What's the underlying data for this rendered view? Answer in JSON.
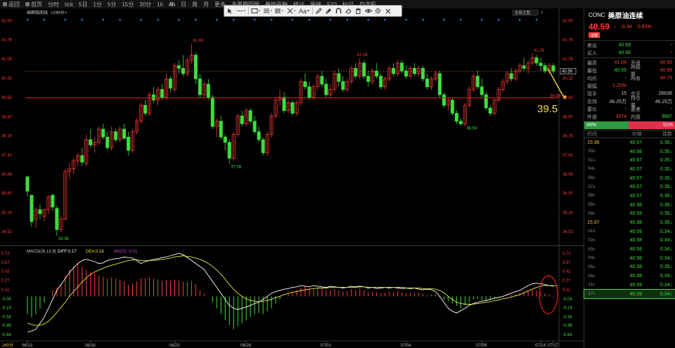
{
  "nav": {
    "items": [
      {
        "label": "返回",
        "icon": "back-icon"
      },
      {
        "label": "首页",
        "icon": "home-icon"
      },
      {
        "label": "分时"
      },
      {
        "label": "tick"
      },
      {
        "label": "5日"
      },
      {
        "label": "1分"
      },
      {
        "label": "5分"
      },
      {
        "label": "15分"
      },
      {
        "label": "30分"
      },
      {
        "label": "1h"
      },
      {
        "label": "4h",
        "active": true
      },
      {
        "label": "日"
      },
      {
        "label": "周"
      },
      {
        "label": "月"
      },
      {
        "label": "更多"
      },
      {
        "label": "多周期同屏"
      },
      {
        "label": "叠加品种"
      },
      {
        "label": "统计"
      },
      {
        "label": "画线"
      },
      {
        "label": "F10"
      },
      {
        "label": "标记"
      },
      {
        "label": "自选股"
      }
    ]
  },
  "chart_header": {
    "label": "画图指南线",
    "period": "<240分>",
    "dropdown": "全部主图"
  },
  "toolbar": {
    "font_label": "Aa",
    "icons": [
      "pointer-icon",
      "line-style-icon",
      "rectangle-tool-icon",
      "text-tool-icon",
      "fibonacci-icon",
      "cross-icon",
      "pencil-icon",
      "brush-icon",
      "magnet-icon",
      "eraser-icon",
      "trash-icon",
      "eye-icon",
      "settings-icon",
      "close-icon"
    ]
  },
  "price_axis": {
    "ticks": [
      "42.50",
      "41.78",
      "41.05",
      "40.32",
      "39.60",
      "38.87",
      "38.15",
      "37.42",
      "36.69",
      "35.97",
      "35.24",
      "34.52"
    ],
    "current_price_tag": "40.59",
    "level_tag": "39.58"
  },
  "annotations": {
    "high_label": "41.63",
    "low_label": "34.36",
    "mid_low_label": "37.08",
    "peak2_label": "41.08",
    "trough3_label": "38.54",
    "recent_high_label": "41.26",
    "target_text": "39.5"
  },
  "date_axis": {
    "labels": [
      "06/13",
      "06/18",
      "06/23",
      "06/26",
      "07/01",
      "07/04",
      "07/09",
      "07/14",
      "07/17"
    ],
    "corner_label": "240分"
  },
  "macd": {
    "legend": {
      "name": "MACD(26,12,9)",
      "diff": "DIFF:0.17",
      "dea": "DEA:0.18",
      "macd": "MACD:-0.01"
    },
    "axis_ticks": [
      "0.72",
      "0.57",
      "0.42",
      "0.27",
      "0.11",
      "-0.04",
      "-0.19",
      "-0.34",
      "-0.48",
      "-0.64"
    ]
  },
  "chart_data": {
    "type": "candlestick",
    "ylim": [
      34.1,
      42.7
    ],
    "ohlc": [
      [
        36.6,
        36.6,
        35.85,
        36.05
      ],
      [
        35.9,
        35.9,
        34.7,
        34.9
      ],
      [
        35.0,
        35.45,
        34.65,
        35.35
      ],
      [
        35.35,
        35.55,
        35.0,
        35.2
      ],
      [
        35.1,
        35.4,
        34.9,
        35.35
      ],
      [
        35.35,
        35.9,
        35.2,
        35.85
      ],
      [
        35.9,
        35.95,
        35.3,
        35.45
      ],
      [
        35.4,
        35.5,
        34.36,
        34.6
      ],
      [
        34.6,
        35.1,
        34.5,
        35.0
      ],
      [
        35.0,
        36.9,
        34.95,
        36.8
      ],
      [
        36.8,
        37.1,
        36.5,
        36.9
      ],
      [
        36.9,
        37.3,
        36.7,
        37.2
      ],
      [
        37.2,
        37.5,
        37.0,
        37.4
      ],
      [
        37.4,
        37.7,
        37.0,
        37.15
      ],
      [
        37.1,
        38.2,
        37.0,
        38.0
      ],
      [
        38.0,
        38.4,
        37.7,
        37.8
      ],
      [
        37.8,
        38.1,
        37.5,
        37.9
      ],
      [
        37.9,
        38.5,
        37.8,
        38.4
      ],
      [
        38.4,
        38.6,
        38.0,
        38.1
      ],
      [
        38.1,
        38.3,
        37.6,
        37.7
      ],
      [
        37.7,
        38.5,
        37.6,
        38.3
      ],
      [
        38.3,
        38.4,
        37.9,
        38.0
      ],
      [
        38.0,
        38.5,
        37.9,
        38.4
      ],
      [
        38.4,
        38.6,
        38.0,
        38.05
      ],
      [
        38.1,
        38.3,
        37.4,
        37.6
      ],
      [
        37.6,
        38.4,
        37.5,
        38.3
      ],
      [
        38.3,
        38.8,
        38.2,
        38.7
      ],
      [
        38.7,
        39.4,
        38.6,
        39.3
      ],
      [
        39.3,
        39.5,
        38.9,
        39.0
      ],
      [
        39.0,
        39.8,
        38.9,
        39.7
      ],
      [
        39.7,
        40.0,
        39.4,
        39.5
      ],
      [
        39.5,
        40.0,
        39.3,
        39.9
      ],
      [
        39.9,
        40.1,
        39.5,
        39.6
      ],
      [
        39.6,
        40.5,
        39.5,
        40.3
      ],
      [
        40.3,
        40.4,
        39.8,
        39.95
      ],
      [
        39.9,
        40.9,
        39.8,
        40.8
      ],
      [
        40.8,
        41.0,
        40.5,
        40.7
      ],
      [
        40.7,
        41.2,
        40.4,
        40.5
      ],
      [
        40.5,
        41.1,
        40.4,
        41.0
      ],
      [
        41.0,
        41.63,
        40.9,
        41.2
      ],
      [
        41.2,
        41.3,
        40.1,
        40.3
      ],
      [
        40.3,
        40.5,
        39.6,
        39.7
      ],
      [
        39.7,
        40.2,
        39.6,
        40.1
      ],
      [
        40.1,
        40.3,
        39.5,
        39.6
      ],
      [
        39.6,
        39.7,
        38.4,
        38.5
      ],
      [
        38.5,
        38.8,
        38.1,
        38.7
      ],
      [
        38.7,
        38.9,
        38.0,
        38.1
      ],
      [
        38.1,
        38.2,
        37.6,
        37.9
      ],
      [
        37.9,
        38.0,
        37.08,
        37.3
      ],
      [
        37.3,
        38.3,
        37.2,
        38.2
      ],
      [
        38.2,
        39.0,
        38.1,
        38.9
      ],
      [
        38.9,
        39.1,
        38.5,
        38.6
      ],
      [
        38.6,
        39.2,
        38.5,
        39.1
      ],
      [
        39.1,
        39.2,
        38.6,
        38.7
      ],
      [
        38.7,
        38.9,
        38.2,
        38.3
      ],
      [
        38.3,
        38.5,
        37.9,
        38.0
      ],
      [
        38.0,
        38.1,
        37.4,
        37.5
      ],
      [
        37.5,
        38.3,
        37.4,
        38.2
      ],
      [
        38.2,
        39.0,
        38.1,
        38.9
      ],
      [
        38.9,
        39.6,
        38.8,
        39.5
      ],
      [
        39.5,
        39.9,
        39.3,
        39.6
      ],
      [
        39.6,
        39.8,
        39.0,
        39.1
      ],
      [
        39.1,
        39.5,
        39.0,
        39.4
      ],
      [
        39.4,
        39.5,
        38.9,
        39.0
      ],
      [
        39.0,
        39.5,
        38.9,
        39.4
      ],
      [
        39.4,
        40.3,
        39.3,
        40.2
      ],
      [
        40.2,
        40.5,
        39.9,
        40.0
      ],
      [
        40.0,
        40.2,
        39.5,
        39.6
      ],
      [
        39.6,
        40.1,
        39.5,
        40.0
      ],
      [
        40.0,
        40.5,
        39.9,
        40.4
      ],
      [
        40.4,
        40.6,
        40.0,
        40.1
      ],
      [
        40.1,
        40.3,
        39.6,
        39.7
      ],
      [
        39.7,
        40.1,
        39.6,
        39.9
      ],
      [
        39.9,
        40.6,
        39.8,
        40.5
      ],
      [
        40.5,
        40.7,
        40.0,
        40.2
      ],
      [
        40.2,
        40.4,
        39.8,
        39.9
      ],
      [
        39.9,
        40.3,
        39.8,
        40.2
      ],
      [
        40.2,
        40.8,
        40.1,
        40.7
      ],
      [
        40.7,
        40.9,
        40.3,
        40.4
      ],
      [
        40.4,
        41.08,
        40.3,
        40.9
      ],
      [
        40.9,
        41.0,
        40.3,
        40.4
      ],
      [
        40.4,
        40.6,
        40.0,
        40.2
      ],
      [
        40.2,
        40.7,
        40.1,
        40.6
      ],
      [
        40.6,
        40.9,
        40.3,
        40.4
      ],
      [
        40.4,
        40.5,
        39.9,
        40.0
      ],
      [
        40.0,
        40.4,
        39.9,
        40.3
      ],
      [
        40.3,
        40.8,
        40.2,
        40.7
      ],
      [
        40.7,
        40.9,
        40.4,
        40.5
      ],
      [
        40.5,
        41.0,
        40.4,
        40.9
      ],
      [
        40.9,
        41.0,
        40.5,
        40.6
      ],
      [
        40.6,
        40.8,
        40.3,
        40.4
      ],
      [
        40.4,
        40.8,
        40.3,
        40.7
      ],
      [
        40.7,
        40.9,
        40.4,
        40.5
      ],
      [
        40.5,
        40.8,
        40.4,
        40.7
      ],
      [
        40.7,
        40.8,
        40.2,
        40.3
      ],
      [
        40.3,
        40.5,
        39.9,
        40.0
      ],
      [
        40.0,
        40.4,
        39.9,
        40.3
      ],
      [
        40.3,
        40.6,
        40.2,
        40.5
      ],
      [
        40.5,
        40.6,
        39.6,
        39.7
      ],
      [
        39.7,
        39.8,
        39.2,
        39.3
      ],
      [
        39.3,
        39.6,
        39.1,
        39.5
      ],
      [
        39.5,
        39.6,
        38.9,
        39.0
      ],
      [
        39.0,
        39.1,
        38.6,
        38.7
      ],
      [
        38.7,
        38.8,
        38.54,
        38.6
      ],
      [
        38.6,
        39.4,
        38.5,
        39.3
      ],
      [
        39.3,
        40.0,
        39.2,
        39.9
      ],
      [
        39.9,
        40.5,
        39.8,
        40.4
      ],
      [
        40.4,
        40.6,
        39.9,
        40.0
      ],
      [
        40.0,
        40.3,
        39.6,
        39.7
      ],
      [
        39.7,
        39.8,
        39.1,
        39.2
      ],
      [
        39.2,
        39.3,
        38.9,
        39.0
      ],
      [
        39.0,
        39.6,
        38.9,
        39.5
      ],
      [
        39.5,
        40.0,
        39.4,
        39.9
      ],
      [
        39.9,
        40.3,
        39.8,
        40.2
      ],
      [
        40.2,
        40.6,
        40.1,
        40.5
      ],
      [
        40.5,
        40.7,
        40.2,
        40.3
      ],
      [
        40.3,
        40.7,
        40.2,
        40.6
      ],
      [
        40.6,
        40.9,
        40.5,
        40.8
      ],
      [
        40.8,
        41.1,
        40.6,
        40.7
      ],
      [
        40.7,
        41.0,
        40.5,
        40.9
      ],
      [
        40.9,
        41.26,
        40.8,
        41.1
      ],
      [
        41.1,
        41.2,
        40.8,
        40.9
      ],
      [
        40.9,
        41.1,
        40.6,
        40.8
      ],
      [
        40.8,
        40.9,
        40.5,
        40.6
      ],
      [
        40.6,
        40.9,
        40.5,
        40.8
      ],
      [
        40.8,
        40.9,
        40.5,
        40.59
      ]
    ],
    "macd_hist": [
      -0.3,
      -0.35,
      -0.3,
      -0.2,
      -0.1,
      0.0,
      0.1,
      0.15,
      0.2,
      0.35,
      0.45,
      0.5,
      0.55,
      0.5,
      0.45,
      0.4,
      0.38,
      0.35,
      0.33,
      0.3,
      0.32,
      0.3,
      0.28,
      0.25,
      0.2,
      0.22,
      0.25,
      0.3,
      0.3,
      0.32,
      0.3,
      0.28,
      0.26,
      0.28,
      0.26,
      0.28,
      0.27,
      0.25,
      0.24,
      0.26,
      0.2,
      0.1,
      0.05,
      0.0,
      -0.1,
      -0.2,
      -0.3,
      -0.4,
      -0.48,
      -0.55,
      -0.5,
      -0.45,
      -0.4,
      -0.35,
      -0.3,
      -0.28,
      -0.3,
      -0.25,
      -0.2,
      -0.12,
      -0.05,
      0.0,
      0.05,
      0.08,
      0.1,
      0.15,
      0.18,
      0.14,
      0.12,
      0.15,
      0.13,
      0.1,
      0.1,
      0.12,
      0.1,
      0.08,
      0.09,
      0.12,
      0.1,
      0.13,
      0.1,
      0.07,
      0.08,
      0.07,
      0.05,
      0.06,
      0.08,
      0.07,
      0.09,
      0.07,
      0.05,
      0.06,
      0.05,
      0.06,
      0.04,
      0.02,
      0.03,
      0.04,
      -0.02,
      -0.06,
      -0.08,
      -0.12,
      -0.16,
      -0.2,
      -0.15,
      -0.1,
      -0.05,
      -0.04,
      -0.06,
      -0.08,
      -0.07,
      -0.04,
      -0.02,
      0.0,
      0.02,
      0.02,
      0.04,
      0.06,
      0.07,
      0.08,
      0.1,
      0.1,
      0.08,
      0.05,
      0.03,
      0.01,
      -0.01
    ],
    "diff": [
      -0.6,
      -0.58,
      -0.55,
      -0.45,
      -0.35,
      -0.2,
      -0.05,
      0.1,
      0.2,
      0.3,
      0.4,
      0.48,
      0.55,
      0.6,
      0.62,
      0.6,
      0.58,
      0.55,
      0.56,
      0.6,
      0.62,
      0.63,
      0.64,
      0.66,
      0.65,
      0.64,
      0.6,
      0.55,
      0.58,
      0.6,
      0.62,
      0.63,
      0.65,
      0.66,
      0.68,
      0.7,
      0.72,
      0.7,
      0.65,
      0.6,
      0.55,
      0.5,
      0.45,
      0.35,
      0.25,
      0.15,
      0.05,
      -0.05,
      -0.15,
      -0.2,
      -0.22,
      -0.2,
      -0.18,
      -0.15,
      -0.12,
      -0.1,
      -0.05,
      0.0,
      0.05,
      0.08,
      0.1,
      0.12,
      0.13,
      0.15,
      0.16,
      0.18,
      0.17,
      0.16,
      0.18,
      0.17,
      0.16,
      0.15,
      0.17,
      0.16,
      0.15,
      0.14,
      0.15,
      0.17,
      0.16,
      0.17,
      0.16,
      0.14,
      0.15,
      0.13,
      0.14,
      0.15,
      0.14,
      0.15,
      0.14,
      0.13,
      0.14,
      0.13,
      0.14,
      0.12,
      0.11,
      0.12,
      0.11,
      0.08,
      0.0,
      -0.1,
      -0.2,
      -0.25,
      -0.28,
      -0.24,
      -0.2,
      -0.15,
      -0.12,
      -0.1,
      -0.08,
      -0.07,
      -0.05,
      -0.03,
      -0.02,
      0.0,
      0.03,
      0.05,
      0.08,
      0.1,
      0.14,
      0.18,
      0.21,
      0.22,
      0.21,
      0.2,
      0.18,
      0.17
    ],
    "dea": [
      -0.45,
      -0.47,
      -0.49,
      -0.48,
      -0.46,
      -0.42,
      -0.35,
      -0.27,
      -0.18,
      -0.1,
      0.0,
      0.08,
      0.16,
      0.24,
      0.31,
      0.37,
      0.41,
      0.44,
      0.47,
      0.5,
      0.52,
      0.54,
      0.56,
      0.58,
      0.6,
      0.61,
      0.61,
      0.6,
      0.6,
      0.6,
      0.6,
      0.61,
      0.62,
      0.63,
      0.64,
      0.66,
      0.67,
      0.68,
      0.67,
      0.66,
      0.64,
      0.62,
      0.59,
      0.55,
      0.5,
      0.44,
      0.37,
      0.29,
      0.2,
      0.12,
      0.05,
      0.0,
      -0.04,
      -0.07,
      -0.08,
      -0.09,
      -0.08,
      -0.07,
      -0.05,
      -0.02,
      0.0,
      0.03,
      0.05,
      0.07,
      0.08,
      0.1,
      0.11,
      0.12,
      0.13,
      0.14,
      0.14,
      0.14,
      0.15,
      0.15,
      0.15,
      0.15,
      0.15,
      0.15,
      0.15,
      0.16,
      0.16,
      0.15,
      0.15,
      0.15,
      0.15,
      0.15,
      0.15,
      0.15,
      0.15,
      0.15,
      0.14,
      0.14,
      0.14,
      0.14,
      0.13,
      0.13,
      0.13,
      0.12,
      0.1,
      0.06,
      0.0,
      -0.05,
      -0.1,
      -0.12,
      -0.13,
      -0.13,
      -0.13,
      -0.12,
      -0.11,
      -0.1,
      -0.09,
      -0.07,
      -0.06,
      -0.04,
      -0.03,
      -0.01,
      0.01,
      0.03,
      0.06,
      0.09,
      0.12,
      0.15,
      0.17,
      0.18,
      0.18,
      0.18,
      0.18
    ]
  },
  "quote": {
    "code": "CONC",
    "name": "美原油连续",
    "price": "40.59",
    "arrow": "↓",
    "change": "-0.34",
    "change_pct": "-0.83%",
    "flag": "设置",
    "bid_label": "卖出",
    "bid": "40.59",
    "bid_vol": "-",
    "ask_label": "买入",
    "ask": "40.58",
    "ask_vol": "-",
    "stats": [
      {
        "l1": "最高",
        "v1": "41.04",
        "c1": "red",
        "l2": "开盘",
        "v2": "40.90"
      },
      {
        "l1": "最低",
        "v1": "40.55",
        "c1": "green",
        "l2": "昨结算",
        "v2": "40.93"
      },
      {
        "l1": "均价",
        "v1": "-",
        "c1": "",
        "l2": "昨收",
        "v2": "40.73"
      },
      {
        "l1": "振幅",
        "v1": "1.20%",
        "c1": "red",
        "l2": "",
        "v2": ""
      },
      {
        "l1": "现手",
        "v1": "15",
        "c1": "",
        "l2": "总手",
        "v2": "26636"
      },
      {
        "l1": "总持",
        "v1": "46.25万",
        "c1": "",
        "l2": "持仓量",
        "v2": "46.25万"
      },
      {
        "l1": "委比",
        "v1": "-",
        "c1": "",
        "l2": "委差",
        "v2": "-"
      },
      {
        "l1": "外盘",
        "v1": "3574",
        "c1": "red",
        "l2": "内盘",
        "v2": "3687"
      }
    ],
    "ratio_left": "49%",
    "ratio_right": "51%",
    "ratio_value": 0.49
  },
  "ticks_table": {
    "headers": [
      "时间",
      "价格",
      "现数"
    ],
    "rows": [
      {
        "t": "15:36",
        "p": "40.57",
        "v": "0.36"
      },
      {
        "t": ":50s",
        "p": "40.58",
        "v": "0.35"
      },
      {
        "t": ":51s",
        "p": "40.57",
        "v": "0.35"
      },
      {
        "t": ":54s",
        "p": "40.57",
        "v": "0.35"
      },
      {
        "t": ":56s",
        "p": "40.57",
        "v": "0.35"
      },
      {
        "t": ":57s",
        "p": "40.57",
        "v": "0.35"
      },
      {
        "t": ":58s",
        "p": "40.57",
        "v": "0.35"
      },
      {
        "t": ":58s",
        "p": "40.58",
        "v": "0.35"
      },
      {
        "t": ":59s",
        "p": "40.59",
        "v": "0.35"
      },
      {
        "t": "15:37",
        "p": "40.58",
        "v": "0.35"
      },
      {
        "t": ":01s",
        "p": "40.59",
        "v": "0.34"
      },
      {
        "t": ":02s",
        "p": "40.58",
        "v": "0.34"
      },
      {
        "t": ":03s",
        "p": "40.59",
        "v": "0.34"
      },
      {
        "t": ":04s",
        "p": "40.58",
        "v": "0.34"
      },
      {
        "t": ":05s",
        "p": "40.58",
        "v": "0.35"
      },
      {
        "t": ":06s",
        "p": "40.58",
        "v": "0.34"
      },
      {
        "t": ":11s",
        "p": "40.59",
        "v": "0.34"
      },
      {
        "t": ":17s",
        "p": "40.59",
        "v": "0.34",
        "selected": true
      }
    ]
  },
  "colors": {
    "up": "#ff3b3b",
    "down": "#3fdc3f",
    "diff_line": "#ffffff",
    "dea_line": "#e8e84a",
    "level_line": "#d02020",
    "arrow": "#f0e040"
  }
}
